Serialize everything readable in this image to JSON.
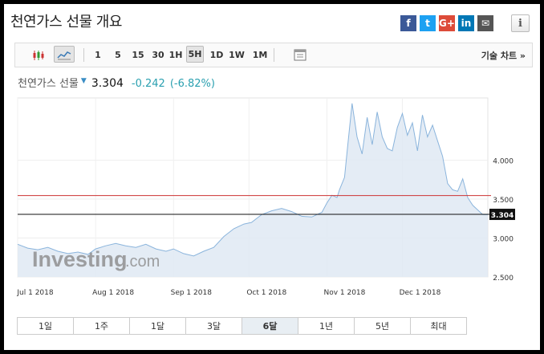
{
  "header": {
    "title": "천연가스 선물 개요",
    "social": [
      {
        "name": "facebook-icon",
        "glyph": "f",
        "color": "#3b5998"
      },
      {
        "name": "twitter-icon",
        "glyph": "t",
        "color": "#1da1f2"
      },
      {
        "name": "google-plus-icon",
        "glyph": "G+",
        "color": "#dd4b39"
      },
      {
        "name": "linkedin-icon",
        "glyph": "in",
        "color": "#0077b5"
      },
      {
        "name": "email-icon",
        "glyph": "✉",
        "color": "#555555"
      }
    ],
    "info_glyph": "i"
  },
  "toolbar": {
    "intervals": [
      "1",
      "5",
      "15",
      "30",
      "1H",
      "5H",
      "1D",
      "1W",
      "1M"
    ],
    "active_interval": "5H",
    "tech_chart": "기술 차트 »"
  },
  "quote": {
    "name": "천연가스 선물",
    "arrow": "▼",
    "price": "3.304",
    "change": "-0.242",
    "change_pct": "(-6.82%)"
  },
  "watermark": {
    "brand": "Investing",
    "suffix": ".com"
  },
  "chart_data": {
    "type": "area",
    "x_ticks": [
      "Jul 1 2018",
      "Aug 1 2018",
      "Sep 1 2018",
      "Oct 1 2018",
      "Nov 1 2018",
      "Dec 1 2018"
    ],
    "y_ticks": [
      "4.000",
      "3.500",
      "3.000",
      "2.500"
    ],
    "ylim": [
      2.5,
      4.8
    ],
    "reference_lines": [
      {
        "value": 3.546,
        "color": "#cc3333"
      },
      {
        "value": 3.304,
        "color": "#111111"
      }
    ],
    "last_price_label": "3.304",
    "series": [
      {
        "x_days": [
          0,
          4,
          8,
          12,
          16,
          20,
          24,
          28,
          31,
          35,
          39,
          43,
          47,
          51,
          55,
          59,
          62,
          66,
          70,
          74,
          78,
          82,
          86,
          90,
          93,
          97,
          101,
          105,
          109,
          113,
          117,
          121,
          123,
          125,
          127,
          128,
          130,
          131,
          133,
          135,
          137,
          139,
          141,
          143,
          145,
          147,
          149,
          151,
          153,
          155,
          157,
          159,
          161,
          163,
          165,
          167,
          169,
          171,
          173,
          175,
          177,
          179,
          181,
          183,
          185,
          187
        ],
        "values": [
          2.92,
          2.87,
          2.85,
          2.88,
          2.83,
          2.8,
          2.82,
          2.79,
          2.86,
          2.9,
          2.93,
          2.9,
          2.88,
          2.92,
          2.86,
          2.83,
          2.86,
          2.8,
          2.77,
          2.83,
          2.88,
          3.02,
          3.12,
          3.18,
          3.2,
          3.3,
          3.35,
          3.38,
          3.34,
          3.28,
          3.27,
          3.33,
          3.45,
          3.55,
          3.52,
          3.62,
          3.78,
          4.1,
          4.73,
          4.3,
          4.08,
          4.55,
          4.2,
          4.62,
          4.3,
          4.15,
          4.12,
          4.42,
          4.6,
          4.32,
          4.48,
          4.12,
          4.58,
          4.3,
          4.45,
          4.25,
          4.05,
          3.7,
          3.62,
          3.6,
          3.76,
          3.52,
          3.42,
          3.36,
          3.3,
          3.3
        ]
      }
    ]
  },
  "periods": [
    "1일",
    "1주",
    "1달",
    "3달",
    "6달",
    "1년",
    "5년",
    "최대"
  ],
  "active_period": "6달"
}
